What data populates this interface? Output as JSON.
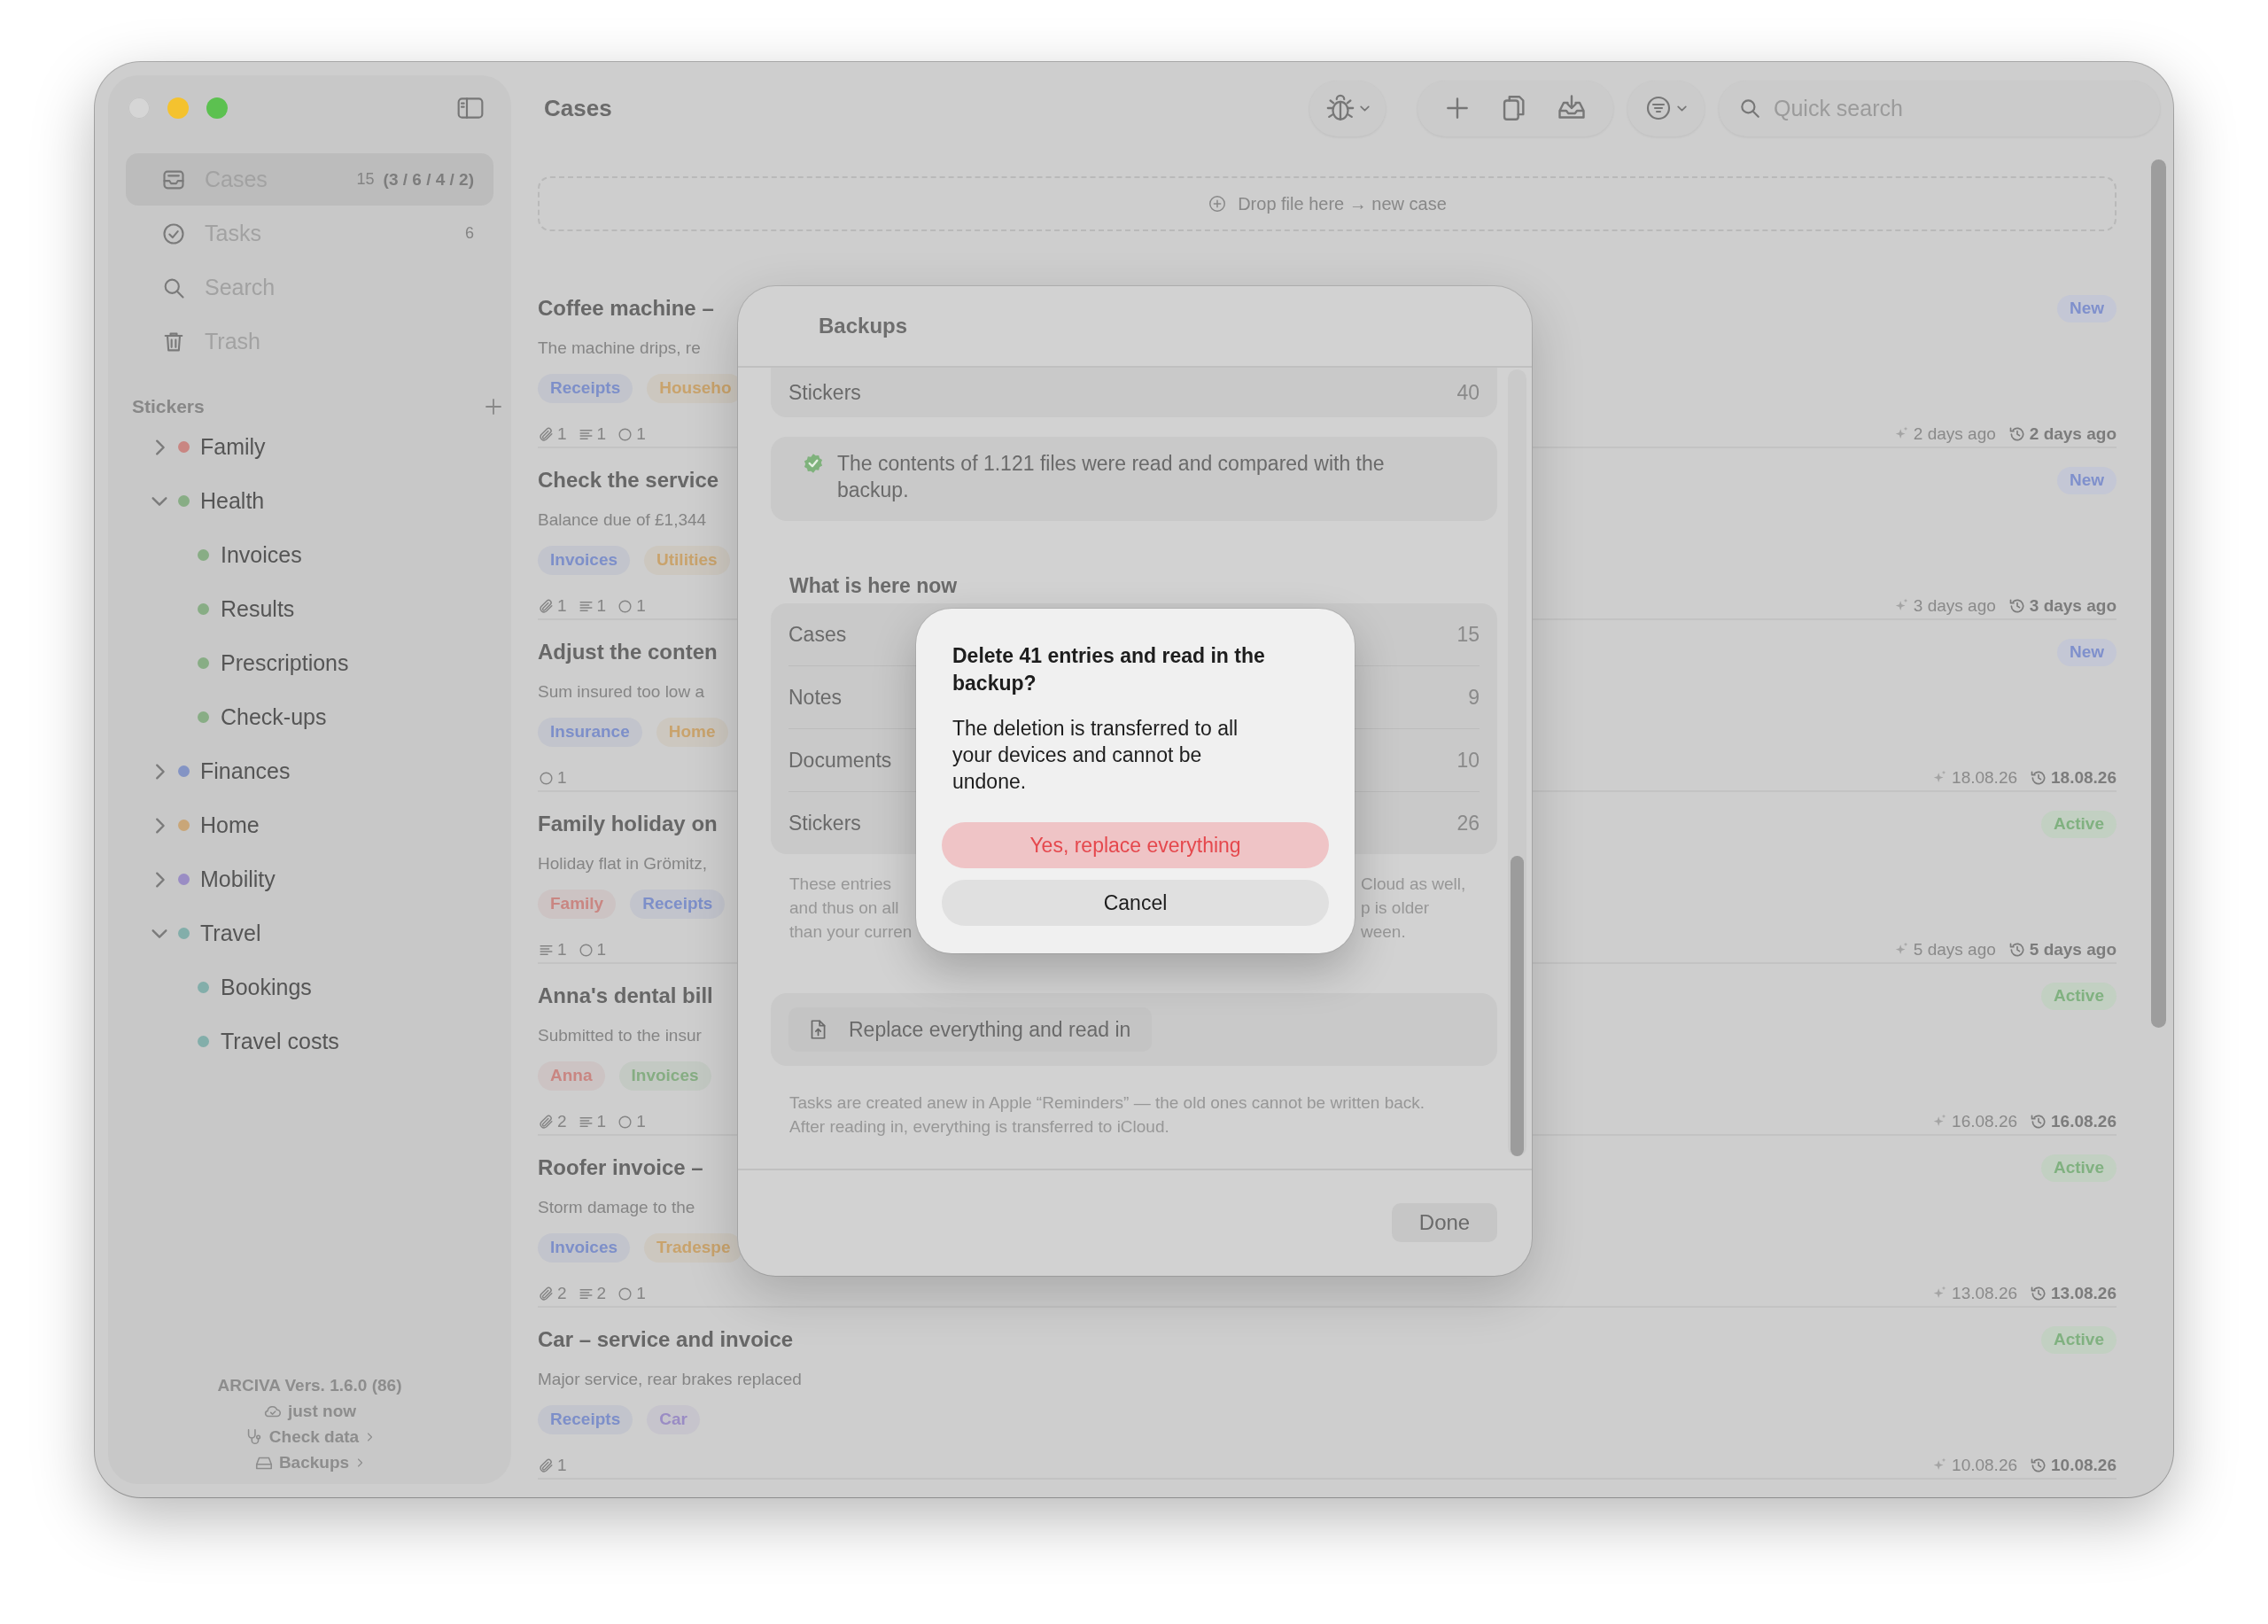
{
  "sidebar": {
    "nav": [
      {
        "label": "Cases",
        "count": "15",
        "detail": "(3 / 6 / 4 / 2)",
        "selected": true
      },
      {
        "label": "Tasks",
        "count": "6",
        "selected": false
      },
      {
        "label": "Search",
        "selected": false
      },
      {
        "label": "Trash",
        "selected": false
      }
    ],
    "stickers_header": "Stickers",
    "stickers": [
      {
        "label": "Family",
        "color": "#c98682",
        "expanded": false
      },
      {
        "label": "Health",
        "color": "#88ad85",
        "expanded": true,
        "children": [
          {
            "label": "Invoices",
            "color": "#88ad85"
          },
          {
            "label": "Results",
            "color": "#88ad85"
          },
          {
            "label": "Prescriptions",
            "color": "#88ad85"
          },
          {
            "label": "Check-ups",
            "color": "#88ad85"
          }
        ]
      },
      {
        "label": "Finances",
        "color": "#8494c4",
        "expanded": false
      },
      {
        "label": "Home",
        "color": "#c9a678",
        "expanded": false
      },
      {
        "label": "Mobility",
        "color": "#9a8dc4",
        "expanded": false
      },
      {
        "label": "Travel",
        "color": "#83aeaa",
        "expanded": true,
        "children": [
          {
            "label": "Bookings",
            "color": "#83aeaa"
          },
          {
            "label": "Travel costs",
            "color": "#83aeaa"
          }
        ]
      }
    ],
    "footer": {
      "version": "ARCIVA  Vers. 1.6.0 (86)",
      "sync": "just now",
      "links": [
        "Check data",
        "Backups"
      ]
    }
  },
  "toolbar": {
    "title": "Cases",
    "search": {
      "placeholder": "Quick search"
    }
  },
  "drop_zone": "Drop file here → new case",
  "cases": [
    {
      "title": "Coffee machine –",
      "description": "The machine drips, re",
      "tags": [
        {
          "label": "Receipts",
          "color": "#7d8fc9"
        },
        {
          "label": "Househo",
          "color": "#c9a36c"
        }
      ],
      "counts": [
        {
          "kind": "attachments",
          "value": "1"
        },
        {
          "kind": "notes",
          "value": "1"
        },
        {
          "kind": "tasks",
          "value": "1"
        }
      ],
      "status": {
        "kind": "new",
        "label": "New"
      },
      "created": "2 days ago",
      "modified": "2 days ago"
    },
    {
      "title": "Check the service",
      "description": "Balance due of £1,344",
      "tags": [
        {
          "label": "Invoices",
          "color": "#7d8fc9"
        },
        {
          "label": "Utilities",
          "color": "#c9a36c"
        }
      ],
      "counts": [
        {
          "kind": "attachments",
          "value": "1"
        },
        {
          "kind": "notes",
          "value": "1"
        },
        {
          "kind": "tasks",
          "value": "1"
        }
      ],
      "status": {
        "kind": "new",
        "label": "New"
      },
      "created": "3 days ago",
      "modified": "3 days ago"
    },
    {
      "title": "Adjust the conten",
      "description": "Sum insured too low a",
      "tags": [
        {
          "label": "Insurance",
          "color": "#7d8fc9"
        },
        {
          "label": "Home",
          "color": "#c9a36c"
        }
      ],
      "counts": [
        {
          "kind": "tasks",
          "value": "1"
        }
      ],
      "status": {
        "kind": "new",
        "label": "New"
      },
      "created": "18.08.26",
      "modified": "18.08.26"
    },
    {
      "title": "Family holiday on",
      "description": "Holiday flat in Grömitz,",
      "tags": [
        {
          "label": "Family",
          "color": "#c98682"
        },
        {
          "label": "Receipts",
          "color": "#7d8fc9"
        }
      ],
      "counts": [
        {
          "kind": "notes",
          "value": "1"
        },
        {
          "kind": "tasks",
          "value": "1"
        }
      ],
      "status": {
        "kind": "active",
        "label": "Active"
      },
      "created": "5 days ago",
      "modified": "5 days ago"
    },
    {
      "title": "Anna's dental bill",
      "description": "Submitted to the insur",
      "tags": [
        {
          "label": "Anna",
          "color": "#c98682"
        },
        {
          "label": "Invoices",
          "color": "#86ad83"
        }
      ],
      "counts": [
        {
          "kind": "attachments",
          "value": "2"
        },
        {
          "kind": "notes",
          "value": "1"
        },
        {
          "kind": "tasks",
          "value": "1"
        }
      ],
      "status": {
        "kind": "active",
        "label": "Active"
      },
      "created": "16.08.26",
      "modified": "16.08.26"
    },
    {
      "title": "Roofer invoice –",
      "description": "Storm damage to the",
      "tags": [
        {
          "label": "Invoices",
          "color": "#7d8fc9"
        },
        {
          "label": "Tradespe",
          "color": "#c9a36c"
        }
      ],
      "counts": [
        {
          "kind": "attachments",
          "value": "2"
        },
        {
          "kind": "notes",
          "value": "2"
        },
        {
          "kind": "tasks",
          "value": "1"
        }
      ],
      "status": {
        "kind": "active",
        "label": "Active"
      },
      "created": "13.08.26",
      "modified": "13.08.26"
    },
    {
      "title": "Car – service and invoice",
      "description": "Major service, rear brakes replaced",
      "tags": [
        {
          "label": "Receipts",
          "color": "#7d8fc9"
        },
        {
          "label": "Car",
          "color": "#9a8cc4"
        }
      ],
      "counts": [
        {
          "kind": "attachments",
          "value": "1"
        }
      ],
      "status": {
        "kind": "active",
        "label": "Active"
      },
      "created": "10.08.26",
      "modified": "10.08.26"
    }
  ],
  "backups_sheet": {
    "title": "Backups",
    "backup_rows": [
      {
        "label": "Stickers",
        "value": "40"
      }
    ],
    "verified": "The contents of 1.121 files were read and compared with the backup.",
    "current_heading": "What is here now",
    "current_rows": [
      {
        "label": "Cases",
        "value": "15"
      },
      {
        "label": "Notes",
        "value": "9"
      },
      {
        "label": "Documents",
        "value": "10"
      },
      {
        "label": "Stickers",
        "value": "26"
      }
    ],
    "note_left": [
      "These entries",
      "and thus on all",
      "than your curren"
    ],
    "note_right": [
      "Cloud as well,",
      "p is older",
      "ween."
    ],
    "action": "Replace everything and read in",
    "tasks_note": "Tasks are created anew in Apple “Reminders” — the old ones cannot be written back. After reading in, everything is transferred to iCloud.",
    "done": "Done"
  },
  "alert": {
    "title": "Delete 41 entries and read in the backup?",
    "message": "The deletion is transferred to all your devices and cannot be undone.",
    "buttons": [
      {
        "label": "Yes, replace everything",
        "kind": "destructive"
      },
      {
        "label": "Cancel",
        "kind": "cancel"
      }
    ]
  }
}
